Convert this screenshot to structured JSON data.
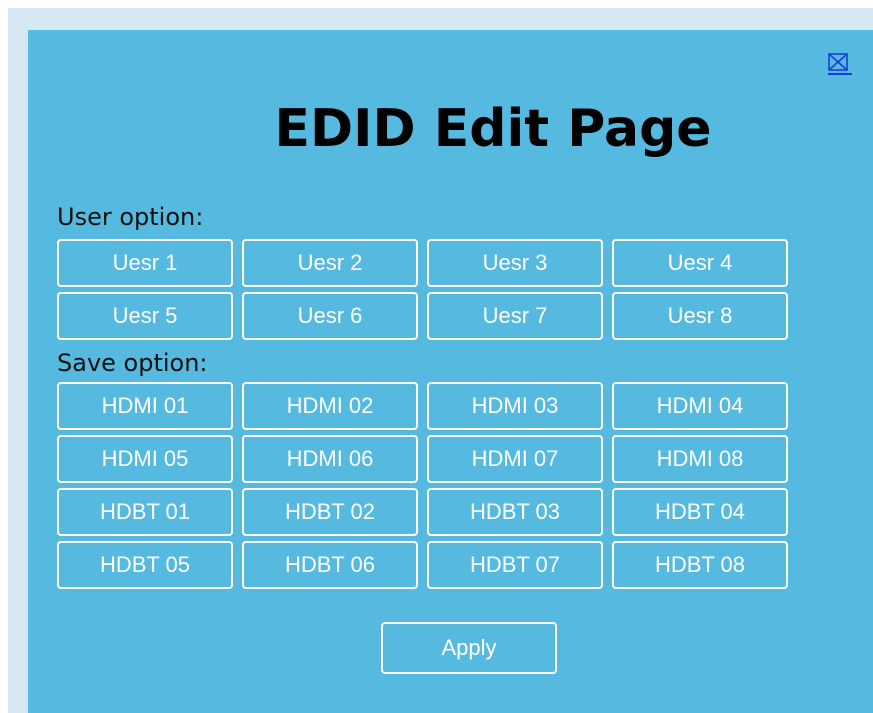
{
  "page": {
    "title": "EDID Edit Page",
    "close_icon": "close-box-icon"
  },
  "user_option": {
    "label": "User option:",
    "buttons": [
      "Uesr 1",
      "Uesr 2",
      "Uesr 3",
      "Uesr 4",
      "Uesr 5",
      "Uesr 6",
      "Uesr 7",
      "Uesr 8"
    ]
  },
  "save_option": {
    "label": "Save option:",
    "buttons": [
      "HDMI 01",
      "HDMI 02",
      "HDMI 03",
      "HDMI 04",
      "HDMI 05",
      "HDMI 06",
      "HDMI 07",
      "HDMI 08",
      "HDBT 01",
      "HDBT 02",
      "HDBT 03",
      "HDBT 04",
      "HDBT 05",
      "HDBT 06",
      "HDBT 07",
      "HDBT 08"
    ]
  },
  "actions": {
    "apply_label": "Apply"
  },
  "colors": {
    "panel_bg": "#55b9e0",
    "frame_bg": "#d6e9f2",
    "button_border": "#ffffff",
    "button_text": "#ffffff",
    "link": "#1a3fd6"
  }
}
